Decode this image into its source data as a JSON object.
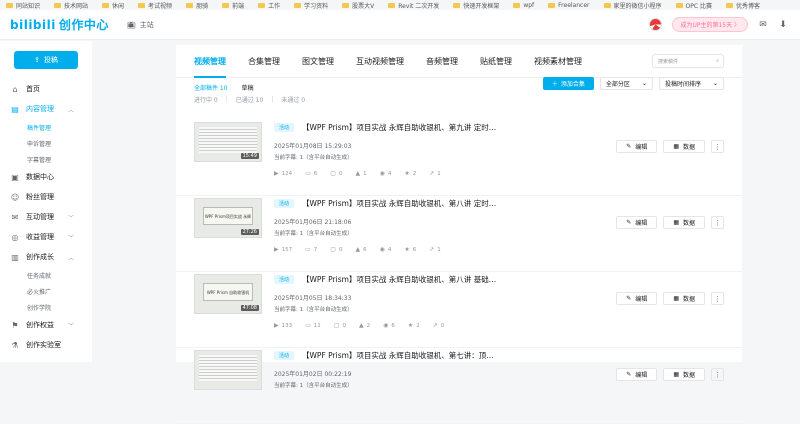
{
  "bookmarks": [
    "同站知识",
    "技术网站",
    "休闲",
    "考试视频",
    "朋骑",
    "前端",
    "工作",
    "学习资料",
    "股票大V",
    "Revit 二次开发",
    "快速开发框架",
    "wpf",
    "Freelancer",
    "家里的微信小程序",
    "OPC 比赛",
    "优秀博客"
  ],
  "header": {
    "logo_mark": "bilibili",
    "logo_text": "创作中心",
    "home_label": "主站",
    "vip_badge": "成为UP主的第15天 〉",
    "colors": {
      "accent": "#00aeec",
      "pink": "#fb7299"
    }
  },
  "sidebar": {
    "upload_label": "投稿",
    "items": [
      {
        "label": "首页",
        "icon": "home-icon",
        "glyph": "⌂"
      },
      {
        "label": "内容管理",
        "icon": "document-icon",
        "glyph": "▤",
        "expanded": true,
        "children": [
          "稿件管理",
          "申诉管理",
          "字幕管理"
        ]
      },
      {
        "label": "数据中心",
        "icon": "chart-icon",
        "glyph": "▣"
      },
      {
        "label": "粉丝管理",
        "icon": "user-icon",
        "glyph": "☺"
      },
      {
        "label": "互动管理",
        "icon": "chat-icon",
        "glyph": "✉",
        "collapsed": true
      },
      {
        "label": "收益管理",
        "icon": "coin-icon",
        "glyph": "◎",
        "collapsed": true
      },
      {
        "label": "创作成长",
        "icon": "book-icon",
        "glyph": "▥",
        "expanded": true,
        "children": [
          "任务成就",
          "必火推广",
          "创作学院"
        ]
      },
      {
        "label": "创作权益",
        "icon": "flag-icon",
        "glyph": "⚑",
        "collapsed": true
      },
      {
        "label": "创作实验室",
        "icon": "lab-icon",
        "glyph": "⚗"
      }
    ]
  },
  "main": {
    "tabs": [
      "视频管理",
      "合集管理",
      "图文管理",
      "互动视频管理",
      "音频管理",
      "贴纸管理",
      "视频素材管理"
    ],
    "search_placeholder": "搜索稿件",
    "filters": {
      "all": "全部稿件 10",
      "draft": "草稿"
    },
    "status": {
      "in_progress": "进行中 0",
      "passed": "已通过 10",
      "not_passed": "未通过 0"
    },
    "add_collection": "添加合集",
    "partition_select": "全部分区",
    "sort_select": "投稿时间排序",
    "edit_label": "编辑",
    "data_label": "数据",
    "videos": [
      {
        "tag": "活动",
        "title": "【WPF Prism】项目实战 永辉自助收银机、第九讲 定时…",
        "date": "2025年01月08日 15:29:03",
        "sub": "当前字幕: 1（含平台自动生成）",
        "duration": "15:49",
        "thumb_style": "code",
        "thumb_text": "",
        "stats": {
          "views": "124",
          "danmaku": "6",
          "comments": "0",
          "likes": "1",
          "coins": "4",
          "favorites": "2",
          "shares": "1"
        }
      },
      {
        "tag": "活动",
        "title": "【WPF Prism】项目实战 永辉自助收银机、第八讲 定时…",
        "date": "2025年01月06日 21:18:06",
        "sub": "当前字幕: 1（含平台自动生成）",
        "duration": "27:26",
        "thumb_style": "card",
        "thumb_text": "WPF Prism项目实战 永辉",
        "stats": {
          "views": "157",
          "danmaku": "7",
          "comments": "0",
          "likes": "6",
          "coins": "4",
          "favorites": "6",
          "shares": "1"
        }
      },
      {
        "tag": "活动",
        "title": "【WPF Prism】项目实战 永辉自助收银机、第八讲 基础…",
        "date": "2025年01月05日 18:34:33",
        "sub": "当前字幕: 1（含平台自动生成）",
        "duration": "47:08",
        "thumb_style": "card",
        "thumb_text": "WPF Prism 自助收银机",
        "stats": {
          "views": "133",
          "danmaku": "11",
          "comments": "0",
          "likes": "2",
          "coins": "6",
          "favorites": "2",
          "shares": "0"
        }
      },
      {
        "tag": "活动",
        "title": "【WPF Prism】项目实战 永辉自助收银机、第七讲：顶…",
        "date": "2025年01月02日 00:22:19",
        "sub": "当前字幕: 1（含平台自动生成）",
        "duration": "",
        "thumb_style": "code",
        "thumb_text": "",
        "stats": {
          "views": "",
          "danmaku": "",
          "comments": "",
          "likes": "",
          "coins": "",
          "favorites": "",
          "shares": ""
        }
      }
    ]
  }
}
